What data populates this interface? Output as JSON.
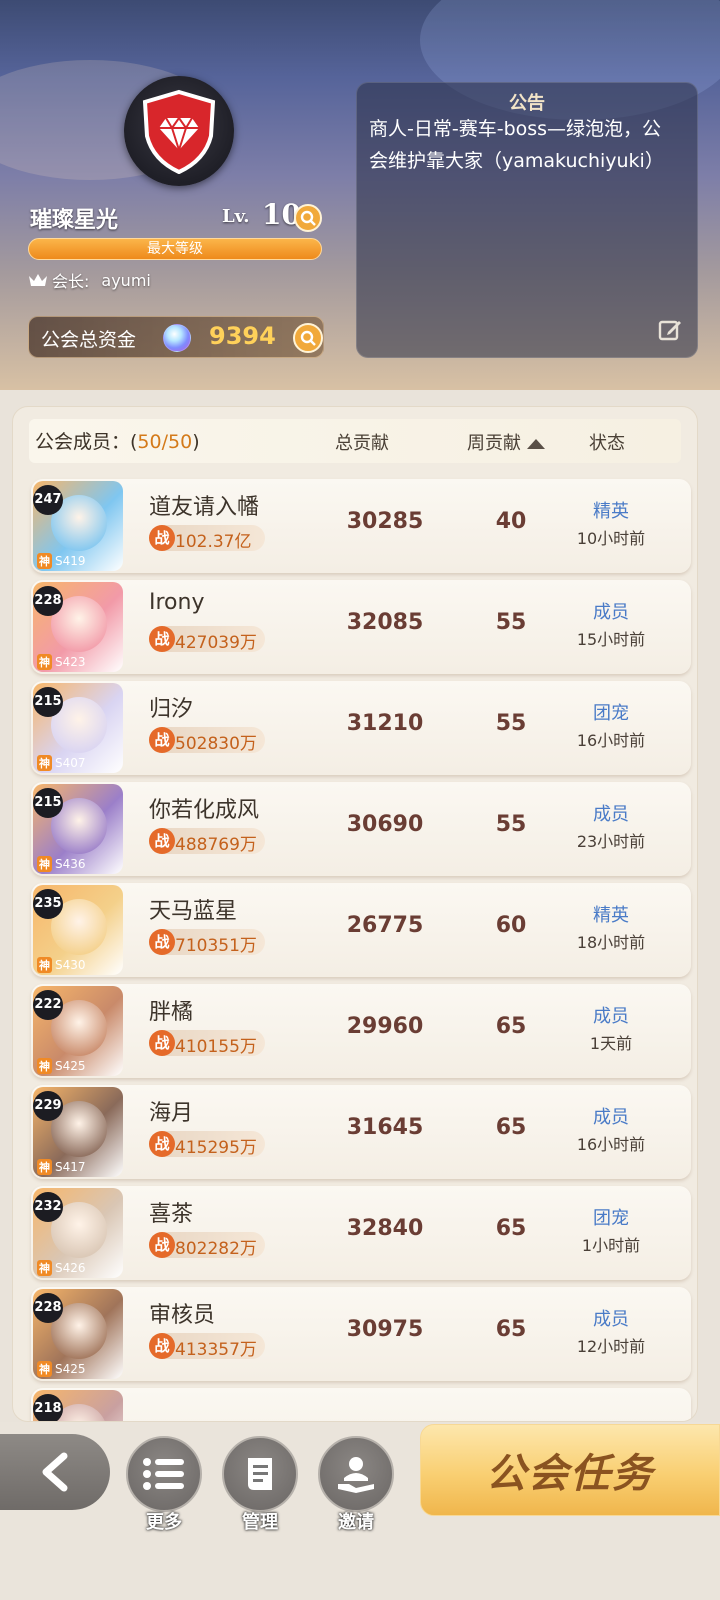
{
  "guild": {
    "name": "璀璨星光",
    "lv_label": "Lv.",
    "level": "10",
    "level_bar_text": "最大等级",
    "leader_label": "会长:",
    "leader_name": "ayumi",
    "funds_label": "公会总资金",
    "funds_value": "9394"
  },
  "notice": {
    "title": "公告",
    "text": "商人-日常-赛车-boss—绿泡泡，公会维护靠大家（yamakuchiyuki）"
  },
  "columns": {
    "members_label": "公会成员：(",
    "members_count": "50/50",
    "members_close": ")",
    "total": "总贡献",
    "weekly": "周贡献",
    "status": "状态"
  },
  "members": [
    {
      "level": "247",
      "server": "S419",
      "name": "道友请入幡",
      "power": "102.37亿",
      "total": "30285",
      "weekly": "40",
      "role": "精英",
      "time": "10小时前"
    },
    {
      "level": "228",
      "server": "S423",
      "name": "Irony",
      "power": "427039万",
      "total": "32085",
      "weekly": "55",
      "role": "成员",
      "time": "15小时前"
    },
    {
      "level": "215",
      "server": "S407",
      "name": "归汐",
      "power": "502830万",
      "total": "31210",
      "weekly": "55",
      "role": "团宠",
      "time": "16小时前"
    },
    {
      "level": "215",
      "server": "S436",
      "name": "你若化成风",
      "power": "488769万",
      "total": "30690",
      "weekly": "55",
      "role": "成员",
      "time": "23小时前"
    },
    {
      "level": "235",
      "server": "S430",
      "name": "天马蓝星",
      "power": "710351万",
      "total": "26775",
      "weekly": "60",
      "role": "精英",
      "time": "18小时前"
    },
    {
      "level": "222",
      "server": "S425",
      "name": "胖橘",
      "power": "410155万",
      "total": "29960",
      "weekly": "65",
      "role": "成员",
      "time": "1天前"
    },
    {
      "level": "229",
      "server": "S417",
      "name": "海月",
      "power": "415295万",
      "total": "31645",
      "weekly": "65",
      "role": "成员",
      "time": "16小时前"
    },
    {
      "level": "232",
      "server": "S426",
      "name": "喜茶",
      "power": "802282万",
      "total": "32840",
      "weekly": "65",
      "role": "团宠",
      "time": "1小时前"
    },
    {
      "level": "228",
      "server": "S425",
      "name": "审核员",
      "power": "413357万",
      "total": "30975",
      "weekly": "65",
      "role": "成员",
      "time": "12小时前"
    },
    {
      "level": "218",
      "server": "",
      "name": "",
      "power": "",
      "total": "",
      "weekly": "",
      "role": "",
      "time": ""
    }
  ],
  "badges": {
    "power_char": "战",
    "server_char": "神"
  },
  "avatar_colors": [
    "#7fc6f0",
    "#f29aa8",
    "#d9d4f2",
    "#9b7fc9",
    "#f4d08a",
    "#c98a6a",
    "#8a6a5a",
    "#d9c6b4",
    "#a0745a",
    "#c9a0a0"
  ],
  "toolbar": {
    "more": "更多",
    "manage": "管理",
    "invite": "邀请",
    "task": "公会任务"
  },
  "icons": {
    "emblem": "red-diamond-shield-icon",
    "search": "search-icon",
    "crown": "crown-icon",
    "gem": "gem-icon",
    "edit": "edit-icon",
    "back": "chevron-left-icon",
    "list": "list-icon",
    "manage": "document-icon",
    "invite": "invite-icon"
  }
}
